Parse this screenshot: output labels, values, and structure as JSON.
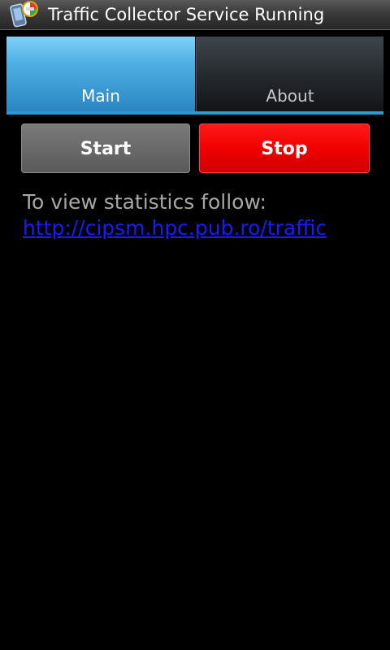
{
  "title_bar": {
    "title": "Traffic Collector Service Running",
    "icon": "traffic-collector-app-icon"
  },
  "tabs": [
    {
      "label": "Main",
      "selected": true
    },
    {
      "label": "About",
      "selected": false
    }
  ],
  "buttons": {
    "start_label": "Start",
    "stop_label": "Stop"
  },
  "content": {
    "info_text": "To view statistics follow:",
    "link_text": "http://cipsm.hpc.pub.ro/traffic"
  },
  "colors": {
    "background": "#000000",
    "tab_selected": "#4fb0e4",
    "tab_unselected": "#262b30",
    "start_button": "#6a6a6a",
    "stop_button": "#f10000",
    "link": "#1a1aff",
    "info_text": "#a7a7a7"
  }
}
